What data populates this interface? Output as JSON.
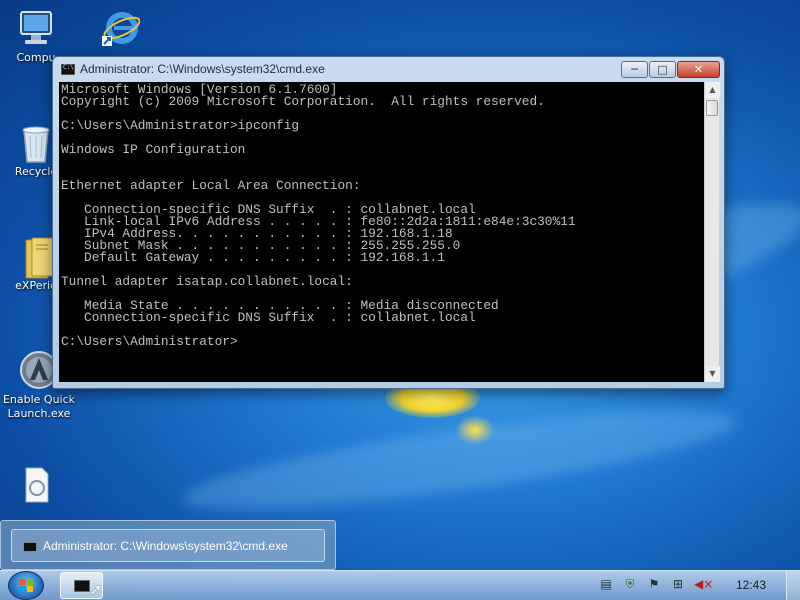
{
  "desktop": {
    "icons": [
      {
        "label": "Compu",
        "icon": "computer-icon"
      },
      {
        "label": "",
        "icon": "internet-explorer-icon"
      },
      {
        "label": "Recycle",
        "icon": "recycle-bin-icon"
      },
      {
        "label": "eXPerie",
        "icon": "folder-icon"
      },
      {
        "label": "Enable Quick Launch.exe",
        "icon": "quick-launch-icon"
      },
      {
        "label": "",
        "icon": "file-icon"
      }
    ]
  },
  "window": {
    "title": "Administrator: C:\\Windows\\system32\\cmd.exe",
    "minimize_label": "─",
    "maximize_label": "□",
    "close_label": "✕",
    "console_lines": [
      "Microsoft Windows [Version 6.1.7600]",
      "Copyright (c) 2009 Microsoft Corporation.  All rights reserved.",
      "",
      "C:\\Users\\Administrator>ipconfig",
      "",
      "Windows IP Configuration",
      "",
      "",
      "Ethernet adapter Local Area Connection:",
      "",
      "   Connection-specific DNS Suffix  . : collabnet.local",
      "   Link-local IPv6 Address . . . . . : fe80::2d2a:1811:e84e:3c30%11",
      "   IPv4 Address. . . . . . . . . . . : 192.168.1.18",
      "   Subnet Mask . . . . . . . . . . . : 255.255.255.0",
      "   Default Gateway . . . . . . . . . : 192.168.1.1",
      "",
      "Tunnel adapter isatap.collabnet.local:",
      "",
      "   Media State . . . . . . . . . . . : Media disconnected",
      "   Connection-specific DNS Suffix  . : collabnet.local",
      "",
      "C:\\Users\\Administrator>"
    ]
  },
  "taskbar": {
    "popup_title": "Administrator: C:\\Windows\\system32\\cmd.exe",
    "clock": "12:43",
    "tray_icons": [
      "document-icon",
      "security-icon",
      "flag-icon",
      "network-icon",
      "volume-muted-icon"
    ]
  }
}
